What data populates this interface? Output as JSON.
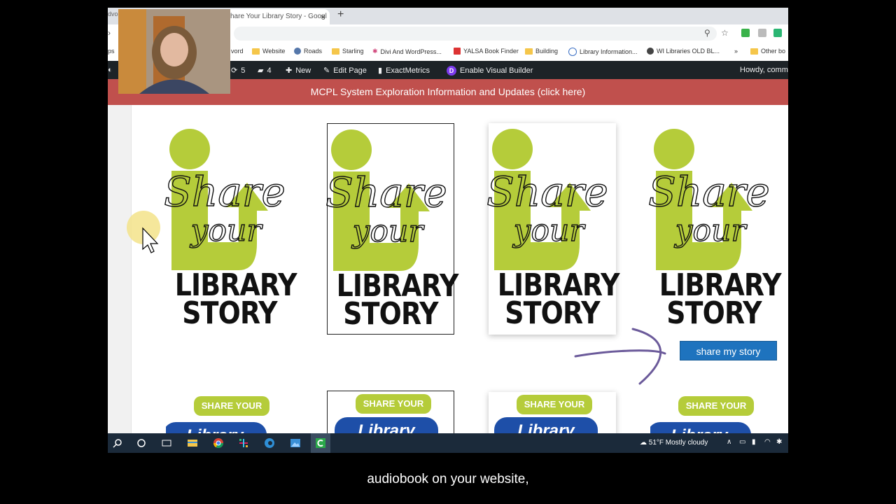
{
  "browser": {
    "tab_fragment": "dvoc",
    "active_tab": "hare Your Library Story - Googl",
    "close_symbol": "×",
    "new_tab_symbol": "+"
  },
  "bookmarks": {
    "items": [
      {
        "label": "ps",
        "kind": "text"
      },
      {
        "label": "vord",
        "kind": "text"
      },
      {
        "label": "Website",
        "kind": "folder"
      },
      {
        "label": "Roads",
        "kind": "folder"
      },
      {
        "label": "Starling",
        "kind": "folder"
      },
      {
        "label": "Divi And WordPress...",
        "kind": "divi"
      },
      {
        "label": "YALSA Book Finder",
        "kind": "yalsa"
      },
      {
        "label": "Building",
        "kind": "folder"
      },
      {
        "label": "Library Information...",
        "kind": "site"
      },
      {
        "label": "WI Libraries OLD BL...",
        "kind": "globe"
      },
      {
        "label": "»",
        "kind": "more"
      },
      {
        "label": "Other bo",
        "kind": "folder"
      }
    ]
  },
  "adminbar": {
    "updates": "5",
    "comments": "4",
    "new_label": "New",
    "edit_label": "Edit Page",
    "metrics_label": "ExactMetrics",
    "divi_letter": "D",
    "builder_label": "Enable Visual Builder",
    "howdy": "Howdy, comm."
  },
  "notice": "MCPL System Exploration Information and Updates (click here)",
  "cards": [
    {
      "script1": "Share",
      "script2": "your",
      "line1": "LIBRARY",
      "line2": "STORY"
    },
    {
      "script1": "Share",
      "script2": "your",
      "line1": "LIBRARY",
      "line2": "STORY"
    },
    {
      "script1": "Share",
      "script2": "your",
      "line1": "LIBRARY",
      "line2": "STORY"
    },
    {
      "script1": "Share",
      "script2": "your",
      "line1": "LIBRARY",
      "line2": "STORY"
    }
  ],
  "share_button": "share my story",
  "row2": [
    {
      "bubble": "SHARE YOUR",
      "blue": "Library"
    },
    {
      "bubble": "SHARE YOUR",
      "blue": "Library"
    },
    {
      "bubble": "SHARE YOUR",
      "blue": "Library"
    },
    {
      "bubble": "SHARE YOUR",
      "blue": "Library"
    }
  ],
  "taskbar": {
    "weather": "51°F  Mostly cloudy"
  },
  "caption": "audiobook on your website,",
  "colors": {
    "accent_green": "#b5cc3a",
    "notice_red": "#c0504d",
    "button_blue": "#1e73be",
    "arrow_purple": "#6b5a9a"
  }
}
